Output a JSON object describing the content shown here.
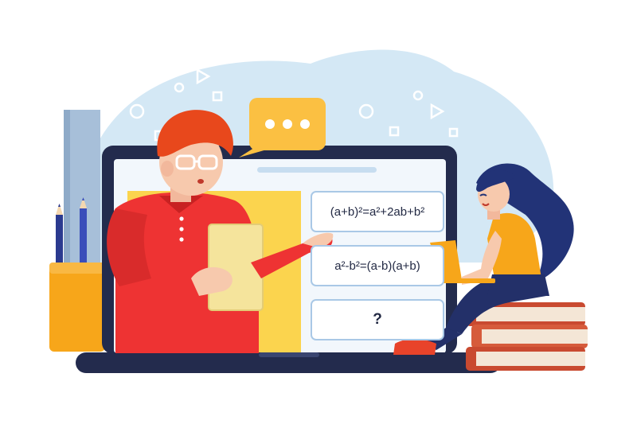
{
  "formulas": [
    {
      "text": "(a+b)²=a²+2ab+b²"
    },
    {
      "text": "a²-b²=(a-b)(a+b)"
    },
    {
      "text": "?"
    }
  ],
  "speech_bubble": {
    "icon": "ellipsis-icon"
  },
  "colors": {
    "background_blob": "#d4e8f5",
    "laptop_frame": "#232b4d",
    "screen_panel_yellow": "#fbd44e",
    "teacher_shirt": "#ee3333",
    "teacher_hair": "#e8481c",
    "speech_bubble": "#fbc042",
    "student_hair": "#223377",
    "student_top": "#f7a61a",
    "books": "#c94a30"
  }
}
